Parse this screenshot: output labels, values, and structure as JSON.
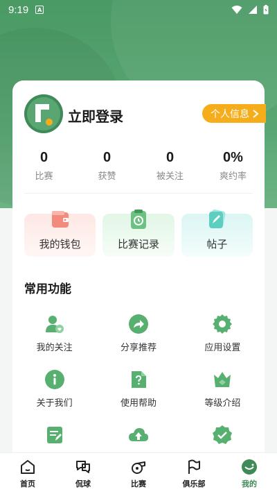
{
  "status_bar": {
    "time": "9:19",
    "notification_icon": "A"
  },
  "profile": {
    "name": "立即登录",
    "info_button": "个人信息"
  },
  "stats": [
    {
      "value": "0",
      "label": "比赛"
    },
    {
      "value": "0",
      "label": "获赞"
    },
    {
      "value": "0",
      "label": "被关注"
    },
    {
      "value": "0%",
      "label": "爽约率"
    }
  ],
  "shortcuts": [
    {
      "label": "我的钱包",
      "icon": "wallet-icon"
    },
    {
      "label": "比赛记录",
      "icon": "match-record-icon"
    },
    {
      "label": "帖子",
      "icon": "post-icon"
    }
  ],
  "section_title": "常用功能",
  "functions": [
    {
      "label": "我的关注",
      "icon": "follow-icon"
    },
    {
      "label": "分享推荐",
      "icon": "share-icon"
    },
    {
      "label": "应用设置",
      "icon": "gear-icon"
    },
    {
      "label": "关于我们",
      "icon": "info-icon"
    },
    {
      "label": "使用帮助",
      "icon": "help-icon"
    },
    {
      "label": "等级介绍",
      "icon": "level-icon"
    }
  ],
  "tabs": [
    {
      "label": "首页",
      "icon": "home-icon"
    },
    {
      "label": "侃球",
      "icon": "chat-icon"
    },
    {
      "label": "比赛",
      "icon": "whistle-icon"
    },
    {
      "label": "俱乐部",
      "icon": "flag-icon"
    },
    {
      "label": "我的",
      "icon": "profile-icon",
      "active": true
    }
  ],
  "colors": {
    "brand_green": "#4a9a64",
    "accent_orange": "#f5ad1b",
    "icon_green": "#57b06f"
  }
}
